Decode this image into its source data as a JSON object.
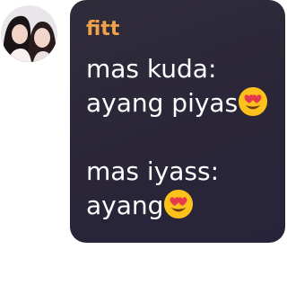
{
  "chat": {
    "sender_name": "fitt",
    "sender_color": "#f0a24a",
    "bubble_color": "#2d2a3a",
    "avatar_icon": "profile-photo-two-people",
    "message_lines": [
      "mas kuda:",
      "ayang piyas",
      "mas iyass:",
      "ayang"
    ],
    "emoji_name": "smiling-face-with-heart-eyes"
  }
}
